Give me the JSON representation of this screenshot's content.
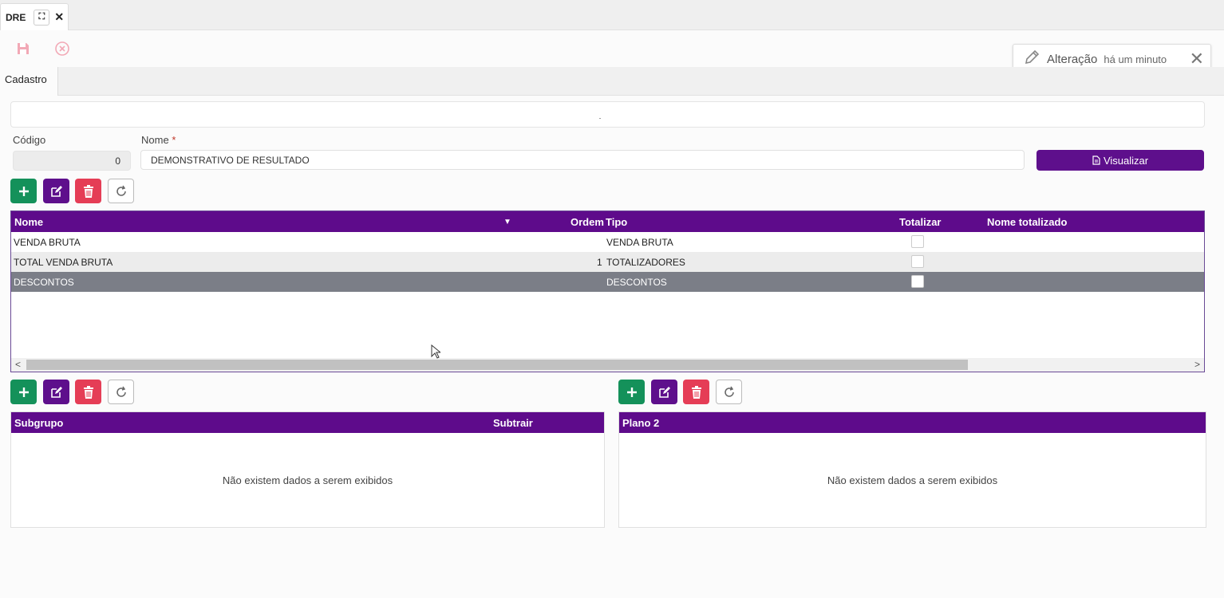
{
  "window": {
    "tab_title": "DRE"
  },
  "notification": {
    "title": "Alteração",
    "time": "há um minuto"
  },
  "sections": {
    "active_tab": "Cadastro"
  },
  "form": {
    "codigo_label": "Código",
    "codigo_value": "0",
    "nome_label": "Nome",
    "nome_required": "*",
    "nome_value": "DEMONSTRATIVO DE RESULTADO",
    "visualizar_label": "Visualizar"
  },
  "main_grid": {
    "columns": [
      "Nome",
      "Ordem",
      "Tipo",
      "Totalizar",
      "Nome totalizado"
    ],
    "sort_indicator": "▼",
    "rows": [
      {
        "nome": "VENDA BRUTA",
        "ordem": "",
        "tipo": "VENDA BRUTA",
        "totalizar": false,
        "nome_totalizado": ""
      },
      {
        "nome": "TOTAL VENDA BRUTA",
        "ordem": "1",
        "tipo": "TOTALIZADORES",
        "totalizar": false,
        "nome_totalizado": ""
      },
      {
        "nome": "DESCONTOS",
        "ordem": "",
        "tipo": "DESCONTOS",
        "totalizar": false,
        "nome_totalizado": ""
      }
    ]
  },
  "subgrupo_grid": {
    "columns": [
      "Subgrupo",
      "Subtrair"
    ],
    "empty_text": "Não existem dados a serem exibidos"
  },
  "plano_grid": {
    "columns": [
      "Plano 2"
    ],
    "empty_text": "Não existem dados a serem exibidos"
  },
  "colors": {
    "primary": "#5e0b8b",
    "add": "#14915a",
    "delete": "#e53d56",
    "selected_row": "#7b7e87"
  }
}
